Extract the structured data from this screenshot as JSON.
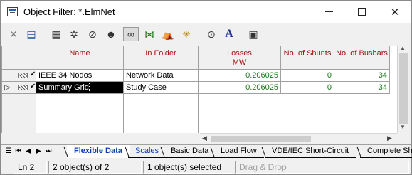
{
  "window": {
    "title": "Object Filter: *.ElmNet",
    "controls": [
      "minimize",
      "maximize",
      "close"
    ]
  },
  "toolbar": {
    "buttons": [
      {
        "name": "delete-icon",
        "glyph": "✕"
      },
      {
        "name": "detail-view-icon",
        "glyph": "▤"
      },
      {
        "name": "edit-object-icon",
        "glyph": "▦"
      },
      {
        "name": "settings-icon",
        "glyph": "✲"
      },
      {
        "name": "filter-icon",
        "glyph": "⊘"
      },
      {
        "name": "user-icon",
        "glyph": "☻"
      },
      {
        "name": "glasses-icon",
        "glyph": "∞"
      },
      {
        "name": "network-icon",
        "glyph": "⋈"
      },
      {
        "name": "tree-icon",
        "glyph": "⛺"
      },
      {
        "name": "new-icon",
        "glyph": "✳"
      },
      {
        "name": "binoculars-icon",
        "glyph": "⊙"
      },
      {
        "name": "font-icon",
        "glyph": "A"
      },
      {
        "name": "save-icon",
        "glyph": "▣"
      }
    ]
  },
  "table": {
    "columns": [
      {
        "label": "Name",
        "sub": ""
      },
      {
        "label": "In Folder",
        "sub": ""
      },
      {
        "label": "Losses",
        "sub": "MW"
      },
      {
        "label": "No. of Shunts",
        "sub": ""
      },
      {
        "label": "No. of Busbars",
        "sub": ""
      }
    ],
    "rows": [
      {
        "name": "IEEE 34 Nodos",
        "folder": "Network Data",
        "losses": "0.206025",
        "shunts": "0",
        "busbars": "34",
        "selected": false
      },
      {
        "name": "Summary Grid",
        "folder": "Study Case",
        "losses": "0.206025",
        "shunts": "0",
        "busbars": "34",
        "selected": true
      }
    ]
  },
  "tabs": [
    {
      "label": "Flexible Data",
      "active": true
    },
    {
      "label": "Scales",
      "active": false
    },
    {
      "label": "Basic Data",
      "active": false
    },
    {
      "label": "Load Flow",
      "active": false
    },
    {
      "label": "VDE/IEC Short-Circuit",
      "active": false
    },
    {
      "label": "Complete Sh",
      "active": false
    }
  ],
  "statusbar": {
    "line": "Ln 2",
    "count": "2 object(s) of 2",
    "selected": "1 object(s) selected",
    "mode": "Drag & Drop"
  }
}
